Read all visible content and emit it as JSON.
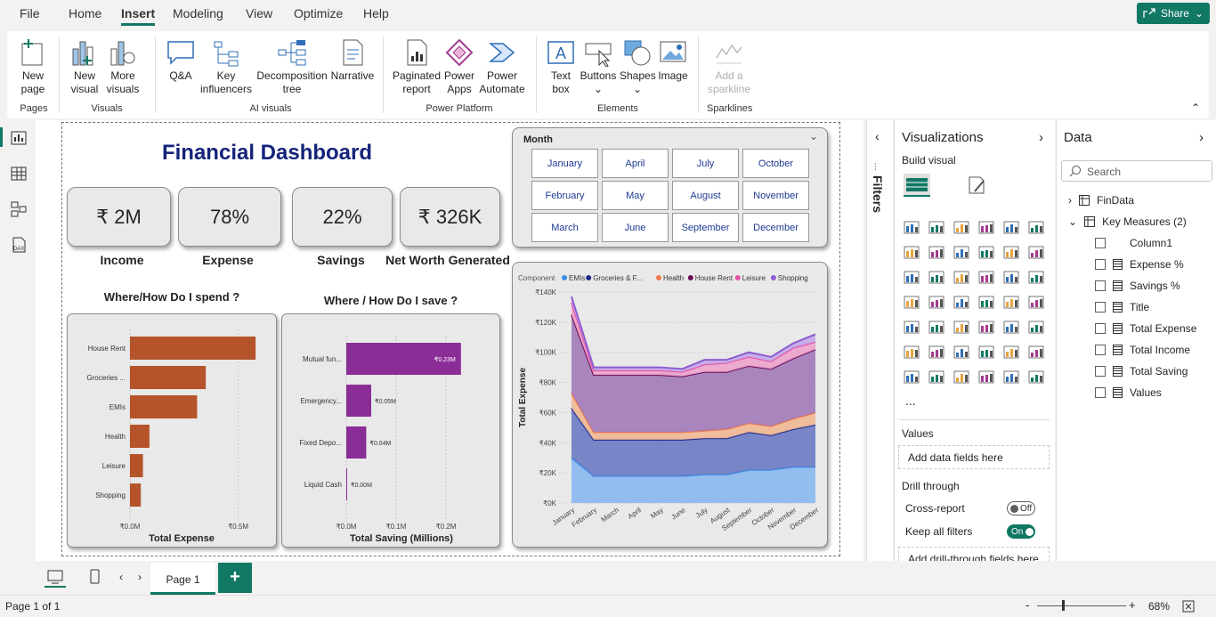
{
  "menu": {
    "file": "File",
    "home": "Home",
    "insert": "Insert",
    "modeling": "Modeling",
    "view": "View",
    "optimize": "Optimize",
    "help": "Help",
    "share": "Share"
  },
  "ribbon": {
    "new_page": "New",
    "new_page2": "page",
    "new_visual": "New",
    "new_visual2": "visual",
    "more_visuals": "More",
    "more_visuals2": "visuals",
    "qa": "Q&A",
    "key_infl": "Key",
    "key_infl2": "influencers",
    "decomp": "Decomposition",
    "decomp2": "tree",
    "narrative": "Narrative",
    "paginated": "Paginated",
    "paginated2": "report",
    "power_apps": "Power",
    "power_apps2": "Apps",
    "power_automate": "Power",
    "power_automate2": "Automate",
    "text_box": "Text",
    "text_box2": "box",
    "buttons": "Buttons",
    "shapes": "Shapes",
    "image": "Image",
    "sparkline": "Add a",
    "sparkline2": "sparkline",
    "g_pages": "Pages",
    "g_visuals": "Visuals",
    "g_ai": "AI visuals",
    "g_pp": "Power Platform",
    "g_elements": "Elements",
    "g_sparklines": "Sparklines"
  },
  "dashboard": {
    "title": "Financial Dashboard",
    "kpis": [
      {
        "value": "₹ 2M",
        "label": "Income"
      },
      {
        "value": "78%",
        "label": "Expense"
      },
      {
        "value": "22%",
        "label": "Savings"
      },
      {
        "value": "₹ 326K",
        "label": "Net Worth Generated"
      }
    ],
    "spend_title": "Where/How Do I spend ?",
    "save_title": "Where / How Do I save ?",
    "slicer_title": "Month",
    "months": [
      "January",
      "April",
      "July",
      "October",
      "February",
      "May",
      "August",
      "November",
      "March",
      "June",
      "September",
      "December"
    ]
  },
  "chart_data": [
    {
      "type": "bar",
      "title": "Where/How Do I spend ?",
      "xlabel": "Total Expense",
      "categories": [
        "House Rent",
        "Groceries ...",
        "EMIs",
        "Health",
        "Leisure",
        "Shopping"
      ],
      "values": [
        0.58,
        0.35,
        0.31,
        0.09,
        0.06,
        0.05
      ],
      "xticks": [
        "₹0.0M",
        "₹0.5M"
      ],
      "xlim": [
        0,
        0.6
      ],
      "color": "#b5542a"
    },
    {
      "type": "bar",
      "title": "Where / How Do I save ?",
      "xlabel": "Total Saving (Millions)",
      "categories": [
        "Mutual fun...",
        "Emergency...",
        "Fixed Depo...",
        "Liquid Cash"
      ],
      "values": [
        0.23,
        0.05,
        0.04,
        0.0
      ],
      "data_labels": [
        "₹0.23M",
        "₹0.05M",
        "₹0.04M",
        "₹0.00M"
      ],
      "xticks": [
        "₹0.0M",
        "₹0.1M",
        "₹0.2M"
      ],
      "xlim": [
        0,
        0.25
      ],
      "color": "#8b2d97"
    },
    {
      "type": "area",
      "ylabel": "Total Expense",
      "legend_title": "Component",
      "categories": [
        "January",
        "February",
        "March",
        "April",
        "May",
        "June",
        "July",
        "August",
        "September",
        "October",
        "November",
        "December"
      ],
      "yticks": [
        "₹0K",
        "₹20K",
        "₹40K",
        "₹60K",
        "₹80K",
        "₹100K",
        "₹120K",
        "₹140K"
      ],
      "ylim": [
        0,
        140000
      ],
      "series": [
        {
          "name": "EMIs",
          "color": "#3b8ee8",
          "fill": "#8ab8ee",
          "values": [
            30000,
            18000,
            18000,
            18000,
            18000,
            18000,
            19000,
            19000,
            22000,
            22000,
            24000,
            24000
          ]
        },
        {
          "name": "Groceries & F...",
          "color": "#1f2a8c",
          "fill": "#6b7bc4",
          "values": [
            33000,
            24000,
            24000,
            24000,
            24000,
            24000,
            24000,
            24000,
            25000,
            23000,
            25000,
            28000
          ]
        },
        {
          "name": "Health",
          "color": "#f07a4c",
          "fill": "#f0b894",
          "values": [
            10000,
            5000,
            5000,
            5000,
            5000,
            5000,
            5000,
            6000,
            6000,
            6000,
            7000,
            8000
          ]
        },
        {
          "name": "House Rent",
          "color": "#6b0f5a",
          "fill": "#a37ab8",
          "values": [
            52000,
            38000,
            38000,
            38000,
            38000,
            37000,
            39000,
            38000,
            38000,
            38000,
            40000,
            42000
          ]
        },
        {
          "name": "Leisure",
          "color": "#e851a8",
          "fill": "#eca3cc",
          "values": [
            8000,
            3000,
            3000,
            3000,
            3000,
            3000,
            5000,
            6000,
            6000,
            5000,
            7000,
            5000
          ]
        },
        {
          "name": "Shopping",
          "color": "#8d5ccf",
          "fill": "#c3a8ea",
          "values": [
            4000,
            2000,
            2000,
            2000,
            2000,
            2000,
            3000,
            2000,
            3000,
            3000,
            3000,
            5000
          ]
        }
      ]
    }
  ],
  "visualizations": {
    "title": "Visualizations",
    "build": "Build visual",
    "values_label": "Values",
    "values_field": "Add data fields here",
    "drill": "Drill through",
    "cross": "Cross-report",
    "cross_state": "Off",
    "keep": "Keep all filters",
    "keep_state": "On",
    "drill_field": "Add drill-through fields here",
    "more": "..."
  },
  "filters": {
    "label": "Filters"
  },
  "data": {
    "title": "Data",
    "search": "Search",
    "tables": [
      {
        "name": "FinData"
      },
      {
        "name": "Key Measures (2)"
      }
    ],
    "fields": [
      "Column1",
      "Expense %",
      "Savings %",
      "Title",
      "Total Expense",
      "Total Income",
      "Total Saving",
      "Values"
    ]
  },
  "tabs": {
    "page1": "Page 1",
    "add": "+"
  },
  "status": {
    "page": "Page 1 of 1",
    "zoom": "68%"
  }
}
